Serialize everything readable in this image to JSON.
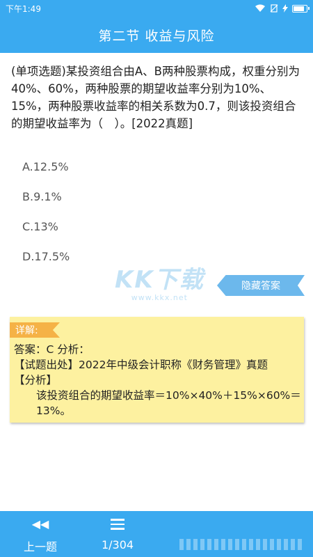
{
  "status_bar": {
    "time": "下午1:49",
    "battery_level": 0.9
  },
  "header": {
    "title": "第二节 收益与风险"
  },
  "question": {
    "text": "(单项选题)某投资组合由A、B两种股票构成，权重分别为40%、60%，两种股票的期望收益率分别为10%、15%，两种股票收益率的相关系数为0.7，则该投资组合的期望收益率为（　）。[2022真题]"
  },
  "options": [
    {
      "label": "A.12.5%"
    },
    {
      "label": "B.9.1%"
    },
    {
      "label": "C.13%"
    },
    {
      "label": "D.17.5%"
    }
  ],
  "watermark": {
    "logo": "KK下载",
    "url": "www.kkx.net"
  },
  "hide_answer_label": "隐藏答案",
  "explanation": {
    "tag": "详解:",
    "answer_line": "答案：C 分析：",
    "source_line": "【试题出处】2022年中级会计职称《财务管理》真题",
    "analysis_heading": "【分析】",
    "analysis_text": "该投资组合的期望收益率＝10%×40%＋15%×60%＝13%。"
  },
  "bottom_bar": {
    "prev_label": "上一题",
    "progress": "1/304"
  },
  "colors": {
    "primary": "#3aaaf0",
    "tag": "#f5b246",
    "explain_bg": "#fdf1a0"
  }
}
